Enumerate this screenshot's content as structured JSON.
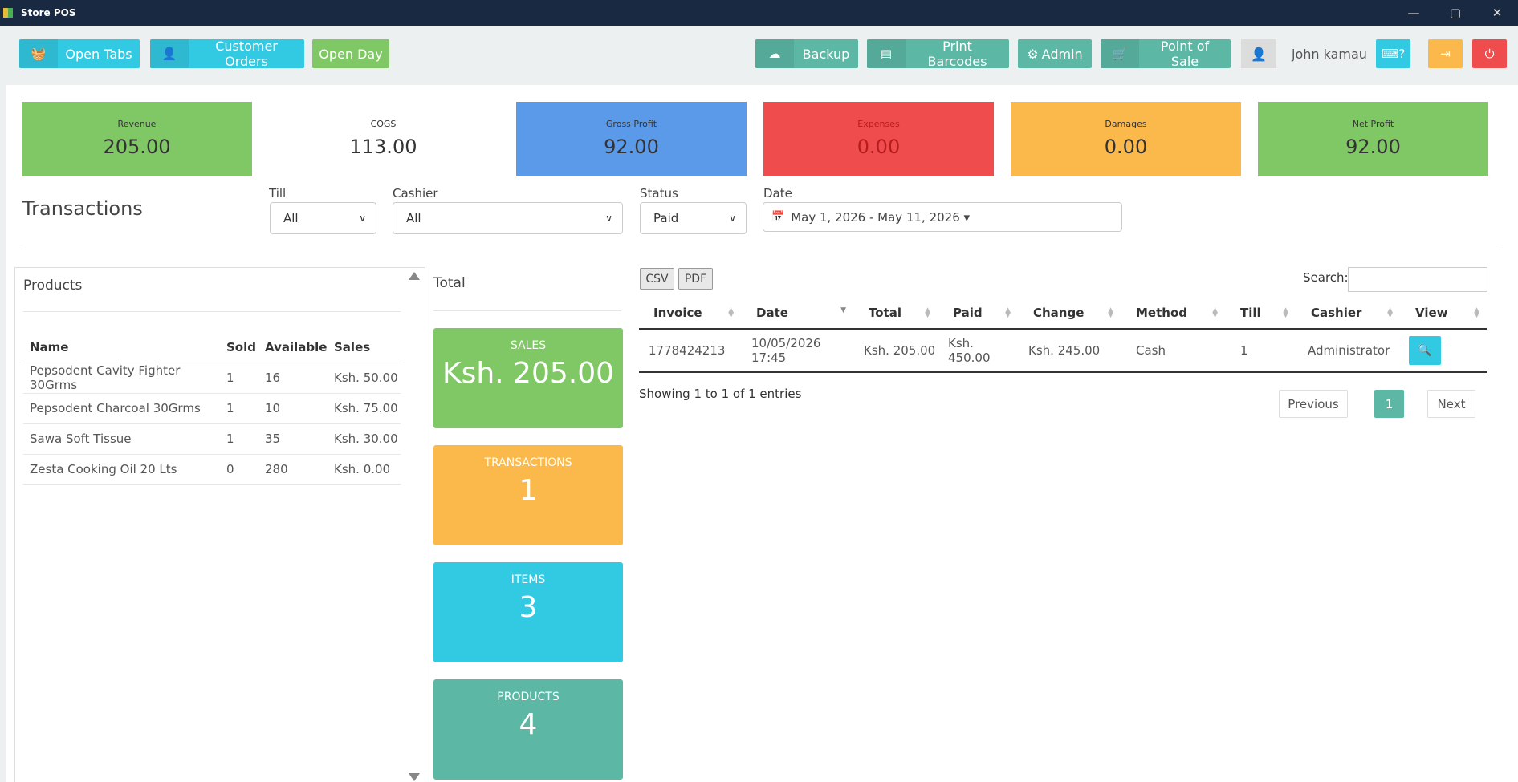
{
  "window": {
    "title": "Store POS",
    "controls": {
      "minimize": "—",
      "maximize": "▢",
      "close": "✕"
    }
  },
  "toolbar": {
    "open_tabs": "Open Tabs",
    "customer_orders": "Customer Orders",
    "open_day": "Open Day",
    "backup": "Backup",
    "print_barcodes": "Print Barcodes",
    "admin": "Admin",
    "point_of_sale": "Point of Sale",
    "user_name": "john kamau",
    "keyboard_help": "⌨?",
    "icons": {
      "basket": "🧺",
      "user": "👤",
      "cloud": "☁",
      "barcode": "▤",
      "gears": "⚙",
      "cart": "🛒",
      "logout": "⇥",
      "power": "⏻"
    }
  },
  "stats": [
    {
      "label": "Revenue",
      "value": "205.00"
    },
    {
      "label": "COGS",
      "value": "113.00"
    },
    {
      "label": "Gross Profit",
      "value": "92.00"
    },
    {
      "label": "Expenses",
      "value": "0.00"
    },
    {
      "label": "Damages",
      "value": "0.00"
    },
    {
      "label": "Net Profit",
      "value": "92.00"
    }
  ],
  "filters": {
    "title": "Transactions",
    "till_label": "Till",
    "till_value": "All",
    "cashier_label": "Cashier",
    "cashier_value": "All",
    "status_label": "Status",
    "status_value": "Paid",
    "date_label": "Date",
    "date_value": "May 1, 2026 - May 11, 2026 ▾"
  },
  "products": {
    "title": "Products",
    "headers": [
      "Name",
      "Sold",
      "Available",
      "Sales"
    ],
    "rows": [
      [
        "Pepsodent Cavity Fighter 30Grms",
        "1",
        "16",
        "Ksh. 50.00"
      ],
      [
        "Pepsodent Charcoal 30Grms",
        "1",
        "10",
        "Ksh. 75.00"
      ],
      [
        "Sawa Soft Tissue",
        "1",
        "35",
        "Ksh. 30.00"
      ],
      [
        "Zesta Cooking Oil 20 Lts",
        "0",
        "280",
        "Ksh. 0.00"
      ]
    ]
  },
  "totals": {
    "title": "Total",
    "sales_label": "SALES",
    "sales_value": "Ksh. 205.00",
    "transactions_label": "TRANSACTIONS",
    "transactions_value": "1",
    "items_label": "ITEMS",
    "items_value": "3",
    "products_label": "PRODUCTS",
    "products_value": "4"
  },
  "transactions": {
    "csv": "CSV",
    "pdf": "PDF",
    "search_label": "Search:",
    "headers": [
      "Invoice",
      "Date",
      "Total",
      "Paid",
      "Change",
      "Method",
      "Till",
      "Cashier",
      "View"
    ],
    "rows": [
      [
        "1778424213",
        "10/05/2026 17:45",
        "Ksh. 205.00",
        "Ksh. 450.00",
        "Ksh. 245.00",
        "Cash",
        "1",
        "Administrator"
      ]
    ],
    "showing": "Showing 1 to 1 of 1 entries",
    "previous": "Previous",
    "page": "1",
    "next": "Next"
  },
  "colors": {
    "cyan": "#32c9e3",
    "green": "#80c865",
    "teal": "#5cb8a5",
    "blue": "#5b9ae8",
    "red": "#ef4d4d",
    "orange": "#fbb94c",
    "titlebar": "#1a2942"
  }
}
